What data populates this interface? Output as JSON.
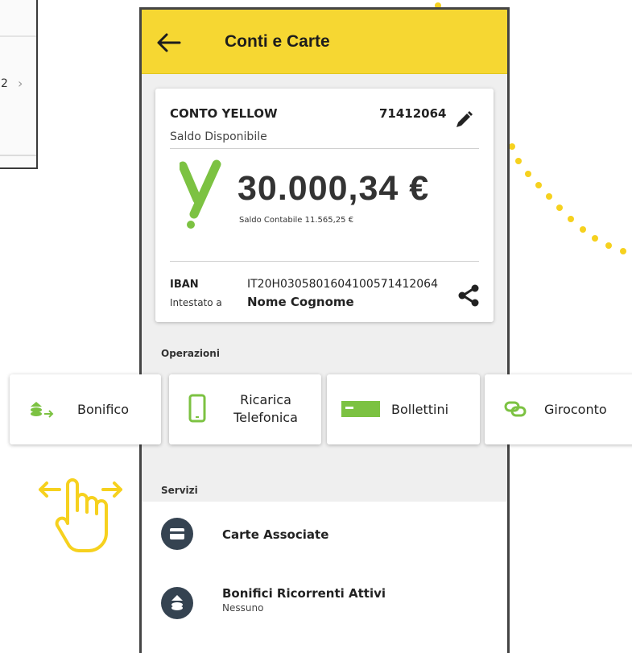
{
  "background_screen": {
    "item_number": "2"
  },
  "app": {
    "title": "Conti e Carte",
    "account": {
      "name": "CONTO YELLOW",
      "number": "71412064",
      "available_label": "Saldo Disponibile",
      "balance": "30.000,34 €",
      "book_balance": "Saldo Contabile 11.565,25 €",
      "iban_label": "IBAN",
      "iban": "IT20H0305801604100571412064",
      "holder_label": "Intestato a",
      "holder": "Nome Cognome",
      "logo_letter": "y"
    },
    "operations_label": "Operazioni",
    "operations": [
      {
        "label": "Bonifico",
        "icon": "transfer-icon"
      },
      {
        "label_line1": "Ricarica",
        "label_line2": "Telefonica",
        "icon": "phone-icon"
      },
      {
        "label": "Bollettini",
        "icon": "bill-icon"
      },
      {
        "label": "Giroconto",
        "icon": "link-icon"
      }
    ],
    "services_label": "Servizi",
    "services": [
      {
        "title": "Carte Associate",
        "icon": "card-icon"
      },
      {
        "title": "Bonifici Ricorrenti Attivi",
        "subtitle": "Nessuno",
        "icon": "recurring-transfer-icon"
      }
    ]
  },
  "colors": {
    "appbar": "#f6d732",
    "accent_green": "#7cc242",
    "service_icon_bg": "#354351",
    "dots": "#f6d11e"
  }
}
